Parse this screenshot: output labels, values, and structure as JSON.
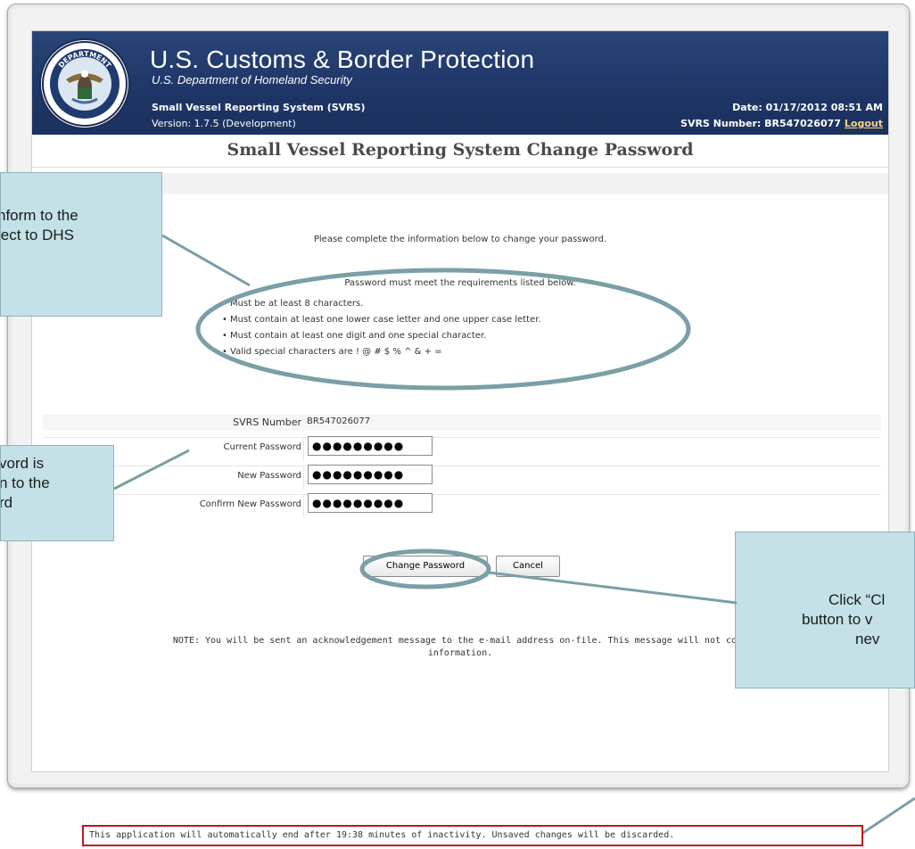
{
  "header": {
    "agency_title": "U.S. Customs & Border Protection",
    "agency_subtitle": "U.S. Department of Homeland Security",
    "system_name": "Small Vessel Reporting System (SVRS)",
    "version": "Version: 1.7.5 (Development)",
    "date": "Date: 01/17/2012 08:51 AM",
    "svrs_number_label": "SVRS Number: BR547026077",
    "logout_label": "Logout",
    "seal_text_top": "DEPARTMENT",
    "seal_text_bottom": "HOMELAND SECURITY",
    "brand_color": "#1e3566"
  },
  "page_title": "Small Vessel Reporting System Change Password",
  "instructions": "Please complete the information below to change your password.",
  "requirements": {
    "title": "Password must meet the requirements listed below.",
    "items": [
      "Must be at least 8 characters.",
      "Must contain at least one lower case letter and one upper case letter.",
      "Must contain at least one digit and one special character.",
      "Valid special characters are ! @ # $ % ^ & + ="
    ]
  },
  "form": {
    "svrs_number_label": "SVRS Number",
    "svrs_number_value": "BR547026077",
    "current_password_label": "Current Password",
    "current_password_value": "●●●●●●●●●",
    "new_password_label": "New Password",
    "new_password_value": "●●●●●●●●●",
    "confirm_password_label": "Confirm New Password",
    "confirm_password_value": "●●●●●●●●●"
  },
  "buttons": {
    "change_password": "Change Password",
    "cancel": "Cancel"
  },
  "note": {
    "line1": "NOTE: You will be sent an acknowledgement message to the e-mail address on-file. This message will not cont",
    "line2": "information."
  },
  "footer_notice": "This application will automatically end after 19:38 minutes of inactivity. Unsaved changes will be discarded.",
  "callouts": {
    "top_left": [
      "nform to the",
      "ject to DHS"
    ],
    "mid_left": [
      "vord is",
      "n to the",
      "rd"
    ],
    "right": [
      "Click “Cl",
      "button to v",
      "nev"
    ]
  },
  "colors": {
    "callout_fill": "#c3e1e6",
    "callout_border": "#8fb3ba",
    "ellipse_stroke": "#7a9fa6",
    "footer_border": "#c0141e"
  }
}
